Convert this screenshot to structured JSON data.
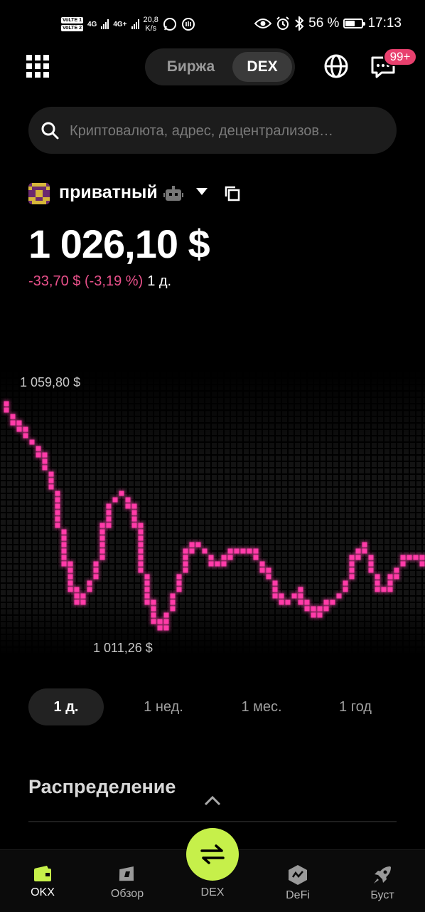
{
  "status_bar": {
    "volte1": "VoLTE 1",
    "volte2": "VoLTE 2",
    "net1": "4G",
    "net2": "4G+",
    "speed_value": "20,8",
    "speed_unit": "K/s",
    "battery_text": "56 %",
    "battery_level": 0.56,
    "time": "17:13"
  },
  "header": {
    "segment": [
      "Биржа",
      "DEX"
    ],
    "active_segment": "DEX",
    "notifications_badge": "99+"
  },
  "search": {
    "placeholder": "Криптовалюта, адрес, децентрализов…"
  },
  "wallet": {
    "name": "приватный",
    "balance": "1 026,10 $",
    "change": "-33,70 $ (-3,19 %)",
    "change_period": "1 д."
  },
  "chart_data": {
    "type": "line",
    "max_label": "1 059,80 $",
    "min_label": "1 011,26 $",
    "y": [
      1059.8,
      1056.3,
      1053.9,
      1052.5,
      1050.4,
      1046.9,
      1041.8,
      1031.6,
      1022.4,
      1017.7,
      1020.5,
      1023.3,
      1033.4,
      1039.4,
      1040.8,
      1038.7,
      1034.1,
      1020.5,
      1014.6,
      1012.7,
      1017.7,
      1022.4,
      1028.3,
      1030.0,
      1028.3,
      1026.6,
      1026.6,
      1028.3,
      1029.0,
      1029.0,
      1027.6,
      1025.9,
      1022.4,
      1018.3,
      1018.7,
      1020.1,
      1017.7,
      1015.6,
      1016.3,
      1018.0,
      1019.4,
      1022.4,
      1028.3,
      1030.0,
      1024.5,
      1020.1,
      1021.8,
      1025.2,
      1027.6,
      1027.6,
      1026.6
    ]
  },
  "periods": [
    "1 д.",
    "1 нед.",
    "1 мес.",
    "1 год"
  ],
  "active_period": "1 д.",
  "distribution_title": "Распределение",
  "bottom_nav": [
    {
      "label": "OKX"
    },
    {
      "label": "Обзор"
    },
    {
      "label": "DEX"
    },
    {
      "label": "DeFi"
    },
    {
      "label": "Буст"
    }
  ],
  "colors": {
    "accent_pink": "#ff3aa8",
    "negative": "#e8508a",
    "fab": "#c6f04a",
    "active_nav": "#c6f04a"
  }
}
